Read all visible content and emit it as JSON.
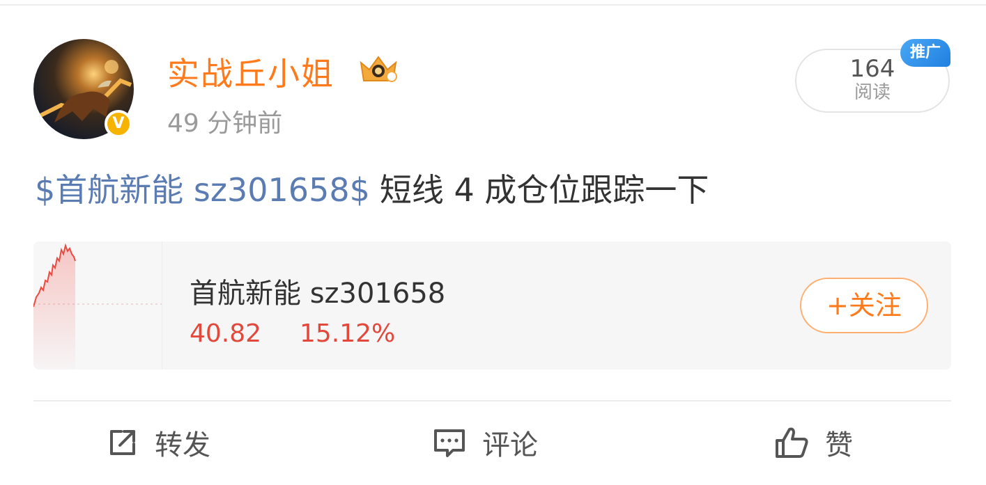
{
  "post": {
    "author": {
      "name": "实战丘小姐",
      "verified_mark": "V"
    },
    "timestamp": "49 分钟前",
    "read_count": "164",
    "read_label": "阅读",
    "promo_tag": "推广",
    "text": {
      "stock_link": "$首航新能 sz301658$",
      "body": "短线 4 成仓位跟踪一下"
    }
  },
  "stock_card": {
    "name": "首航新能 sz301658",
    "price": "40.82",
    "change": "15.12%",
    "follow_label": "+关注",
    "price_color": "#e2483c"
  },
  "actions": {
    "repost_label": "转发",
    "comment_label": "评论",
    "like_label": "赞"
  },
  "colors": {
    "username": "#ff7a1a",
    "stock_link": "#5a7cb2",
    "follow_border": "#ffb071",
    "promo_blue": "#1f7fe0"
  },
  "icons": {
    "badge": "crown-icon",
    "verified": "verified-icon",
    "repost": "repost-icon",
    "comment": "comment-icon",
    "like": "thumbs-up-icon"
  }
}
